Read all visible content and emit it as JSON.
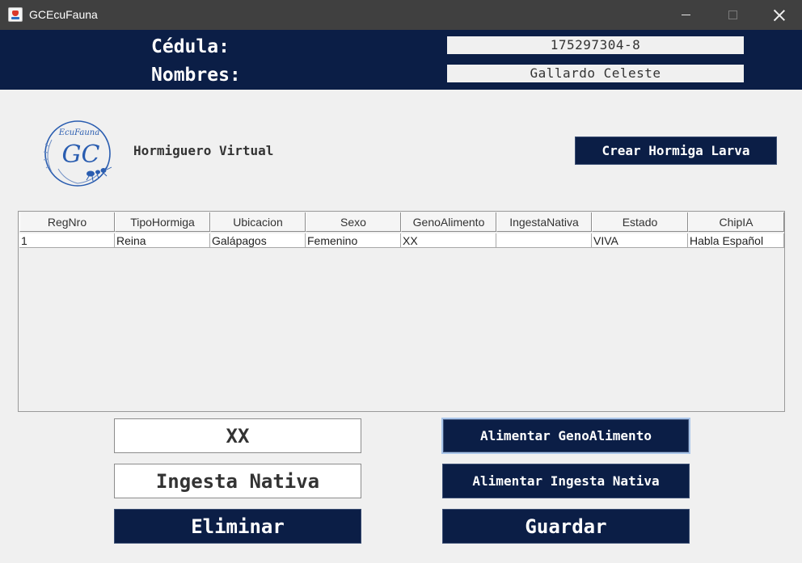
{
  "window": {
    "title": "GCEcuFauna",
    "icon": "java-cup-icon",
    "controls": [
      "minimize-icon",
      "maximize-icon",
      "close-icon"
    ]
  },
  "header": {
    "cedula_label": "Cédula:",
    "cedula_value": "175297304-8",
    "nombres_label": "Nombres:",
    "nombres_value": "Gallardo Celeste"
  },
  "logo": {
    "text_top": "EcuFauna",
    "text_main": "GC"
  },
  "subtitle": "Hormiguero Virtual",
  "buttons": {
    "crear_larva": "Crear Hormiga Larva",
    "alimentar_geno": "Alimentar GenoAlimento",
    "alimentar_ingesta": "Alimentar Ingesta Nativa",
    "eliminar": "Eliminar",
    "guardar": "Guardar"
  },
  "fields": {
    "geno_value": "XX",
    "ingesta_value": "Ingesta Nativa"
  },
  "table": {
    "columns": [
      "RegNro",
      "TipoHormiga",
      "Ubicacion",
      "Sexo",
      "GenoAlimento",
      "IngestaNativa",
      "Estado",
      "ChipIA"
    ],
    "rows": [
      [
        "1",
        "Reina",
        "Galápagos",
        "Femenino",
        "XX",
        "",
        "VIVA",
        "Habla Español"
      ]
    ]
  },
  "colors": {
    "header_bg": "#0b1e46",
    "button_bg": "#0b1e46",
    "window_bg": "#f0f0f0",
    "titlebar_bg": "#404040",
    "logo_blue": "#2a5db0"
  }
}
